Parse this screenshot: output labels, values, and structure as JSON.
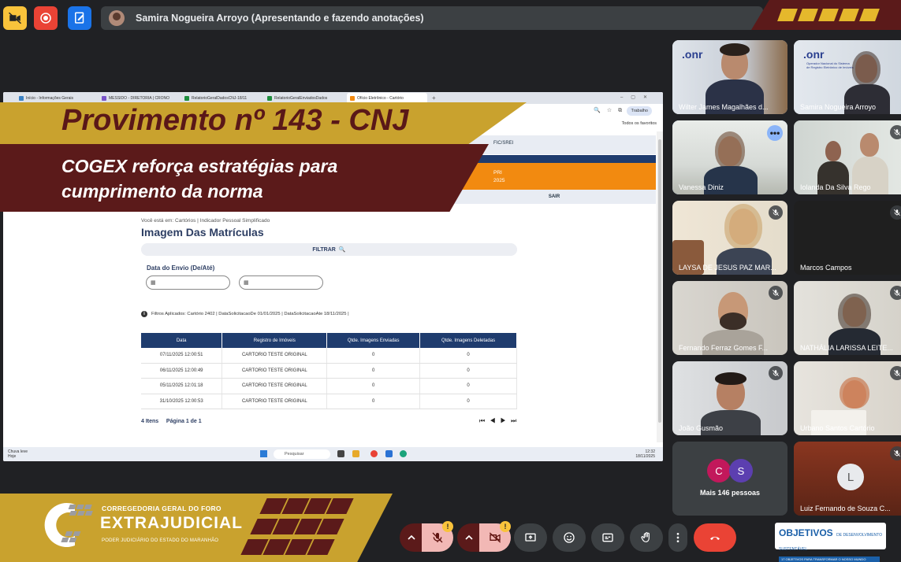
{
  "meet": {
    "presenter_label": "Samira Nogueira Arroyo (Apresentando e fazendo anotações)",
    "more_people": "Mais 146 pessoas",
    "more_avatars": [
      "C",
      "S"
    ],
    "participants": [
      {
        "name": "Wilter James Magalhães d..."
      },
      {
        "name": "Samira Nogueira Arroyo"
      },
      {
        "name": "Vanessa Diniz"
      },
      {
        "name": "Iolanda Da Silva Rego"
      },
      {
        "name": "LAYSA DE JESUS PAZ MAR..."
      },
      {
        "name": "Marcos Campos"
      },
      {
        "name": "Fernando Ferraz Gomes F..."
      },
      {
        "name": "NATHÁLIA LARISSA LEITE..."
      },
      {
        "name": "João Gusmão"
      },
      {
        "name": "Urbano Santos Cartório"
      },
      {
        "name": "Luiz Fernando de Souza C...",
        "initial": "L"
      }
    ],
    "onr_logo": ".onr",
    "onr_sub": "Operador Nacional do Sistema de Registro Eletrônico de Imóveis"
  },
  "overlay": {
    "title": "Provimento nº 143 - CNJ",
    "subtitle_line1": "COGEX  reforça estratégias para",
    "subtitle_line2": "cumprimento da norma"
  },
  "browser": {
    "tabs": [
      {
        "label": "Início - Informações Gerais",
        "color": "#3b82c4"
      },
      {
        "label": "MESSIDO - DIRETORIA | CRONO",
        "color": "#7a55c9"
      },
      {
        "label": "RelatorioGeralDadosCNJ-18/11",
        "color": "#1e8e3e"
      },
      {
        "label": "RelatorioGeralEnviadosDados",
        "color": "#1e8e3e"
      },
      {
        "label": "Ofício Eletrônico - Cartório",
        "color": "#f28a10"
      }
    ],
    "tab_plus": "+",
    "work_label": "Trabalho",
    "bookmarks_label": "Todos os favoritos"
  },
  "app": {
    "menu_item_1": "FIC/SREI",
    "menu_orange_1": "PRI",
    "menu_orange_2": "2025",
    "menu_sair": "SAIR",
    "breadcrumb": "Você está em:  Cartórios  |  Indicador Pessoal Simplificado",
    "page_title": "Imagem Das Matrículas",
    "filter_button": "FILTRAR",
    "date_label": "Data do Envio (De/Até)",
    "filters_applied": "Filtros Aplicados: Cartório 2402  |  DataSolicitacaoDe 01/01/2025  |  DataSolicitacaoAte 18/11/2025  |",
    "table": {
      "headers": [
        "Data",
        "Registro de Imóveis",
        "Qtde. Imagens Enviadas",
        "Qtde. Imagens Deletadas"
      ],
      "rows": [
        [
          "07/11/2025 12:00:51",
          "CARTORIO TESTE ORIGINAL",
          "0",
          "0"
        ],
        [
          "06/11/2025 12:00:49",
          "CARTORIO TESTE ORIGINAL",
          "0",
          "0"
        ],
        [
          "05/11/2025 12:01:18",
          "CARTORIO TESTE ORIGINAL",
          "0",
          "0"
        ],
        [
          "31/10/2025 12:00:53",
          "CARTORIO TESTE ORIGINAL",
          "0",
          "0"
        ]
      ]
    },
    "items_count": "4 Itens",
    "page_info": "Página 1 de 1",
    "pager": "⏮ ◀ ▶ ⏭"
  },
  "taskbar": {
    "weather_1": "Chuva leve",
    "weather_2": "Hoje",
    "search": "Pesquisar",
    "time": "12:32",
    "date": "18/11/2025"
  },
  "footer": {
    "org_line1": "CORREGEDORIA GERAL DO FORO",
    "org_line2": "EXTRAJUDICIAL",
    "org_line3": "PODER JUDICIÁRIO DO ESTADO DO MARANHÃO",
    "warn_symbol": "!",
    "ods_title": "OBJETIVOS",
    "ods_sub": "DE DESENVOLVIMENTO SUSTENTÁVEL",
    "ods_band": "17 OBJETIVOS PARA TRANSFORMAR O NOSSO MUNDO"
  },
  "colors": {
    "gold": "#c9a22e",
    "burgundy": "#5b1a1a",
    "navy": "#1f3c6e",
    "orange": "#f28a10",
    "meet_bg": "#202124",
    "hangup": "#ea4335"
  }
}
